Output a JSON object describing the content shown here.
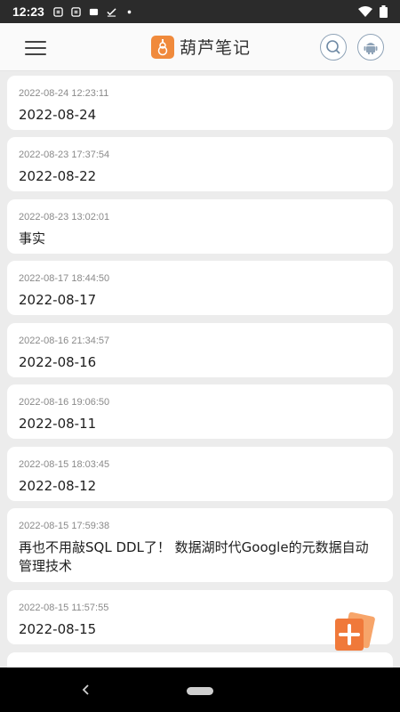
{
  "status_bar": {
    "time": "12:23"
  },
  "app_bar": {
    "title": "葫芦笔记"
  },
  "notes": [
    {
      "timestamp": "2022-08-24 12:23:11",
      "title": "2022-08-24"
    },
    {
      "timestamp": "2022-08-23 17:37:54",
      "title": "2022-08-22"
    },
    {
      "timestamp": "2022-08-23 13:02:01",
      "title": "事实"
    },
    {
      "timestamp": "2022-08-17 18:44:50",
      "title": "2022-08-17"
    },
    {
      "timestamp": "2022-08-16 21:34:57",
      "title": "2022-08-16"
    },
    {
      "timestamp": "2022-08-16 19:06:50",
      "title": "2022-08-11"
    },
    {
      "timestamp": "2022-08-15 18:03:45",
      "title": "2022-08-12"
    },
    {
      "timestamp": "2022-08-15 17:59:38",
      "title": "再也不用敲SQL DDL了！ 数据湖时代Google的元数据自动管理技术"
    },
    {
      "timestamp": "2022-08-15 11:57:55",
      "title": "2022-08-15"
    }
  ],
  "colors": {
    "accent": "#f08a3c",
    "status_bar": "#2b2b2b",
    "background": "#ececec"
  },
  "icons": {
    "menu": "menu-icon",
    "logo": "gourd-logo",
    "search": "search-icon",
    "android": "android-icon",
    "add": "add-note-icon",
    "back": "back-icon"
  }
}
